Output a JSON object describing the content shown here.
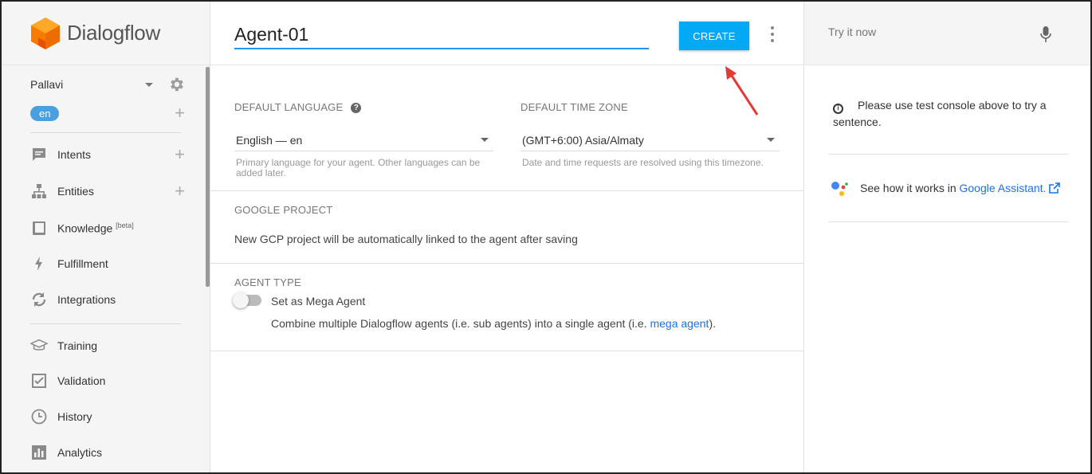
{
  "brand": {
    "name": "Dialogflow"
  },
  "sidebar": {
    "agent_name": "Pallavi",
    "language_pill": "en",
    "items": [
      {
        "label": "Intents",
        "icon": "chat-bubble-icon",
        "has_add": true
      },
      {
        "label": "Entities",
        "icon": "hierarchy-icon",
        "has_add": true
      },
      {
        "label": "Knowledge",
        "beta": "[beta]",
        "icon": "book-icon"
      },
      {
        "label": "Fulfillment",
        "icon": "lightning-icon"
      },
      {
        "label": "Integrations",
        "icon": "sync-icon"
      },
      {
        "label": "Training",
        "icon": "graduation-cap-icon"
      },
      {
        "label": "Validation",
        "icon": "check-box-icon"
      },
      {
        "label": "History",
        "icon": "clock-icon"
      },
      {
        "label": "Analytics",
        "icon": "bar-chart-icon"
      }
    ]
  },
  "main": {
    "agent_name_value": "Agent-01",
    "create_label": "CREATE",
    "default_language": {
      "label": "DEFAULT LANGUAGE",
      "value": "English — en",
      "hint": "Primary language for your agent. Other languages can be added later."
    },
    "default_time_zone": {
      "label": "DEFAULT TIME ZONE",
      "value": "(GMT+6:00) Asia/Almaty",
      "hint": "Date and time requests are resolved using this timezone."
    },
    "google_project": {
      "label": "GOOGLE PROJECT",
      "text": "New GCP project will be automatically linked to the agent after saving"
    },
    "agent_type": {
      "label": "AGENT TYPE",
      "toggle_label": "Set as Mega Agent",
      "description_before": "Combine multiple Dialogflow agents (i.e. sub agents) into a single agent (i.e. ",
      "description_link": "mega agent",
      "description_after": ")."
    }
  },
  "right_panel": {
    "try_placeholder": "Try it now",
    "info_text": "Please use test console above to try a sentence.",
    "assistant_prefix": "See how it works in ",
    "assistant_link": "Google Assistant."
  },
  "colors": {
    "brand_orange": "#ef6c00",
    "accent_blue": "#03a9f4",
    "link_blue": "#1a73e8",
    "annotation_arrow": "#e53935"
  }
}
